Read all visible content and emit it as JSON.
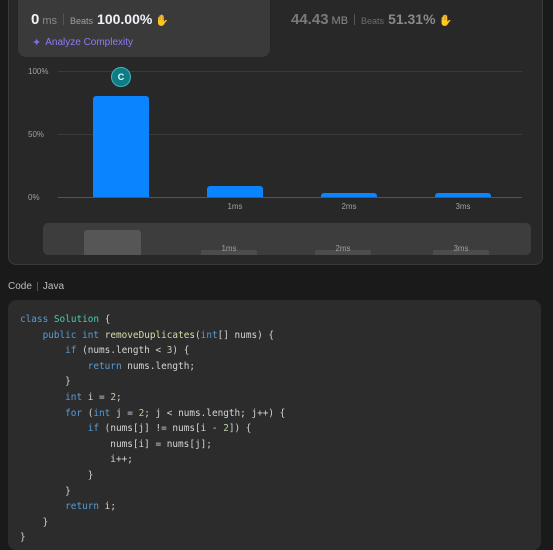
{
  "runtime": {
    "value": "0",
    "unit": "ms",
    "beats_label": "Beats",
    "beats_pct": "100.00%"
  },
  "memory": {
    "value": "44.43",
    "unit": "MB",
    "beats_label": "Beats",
    "beats_pct": "51.31%"
  },
  "analyze_label": "Analyze Complexity",
  "chart_data": {
    "type": "bar",
    "categories": [
      "",
      "1ms",
      "2ms",
      "3ms"
    ],
    "values": [
      80,
      9,
      3,
      3
    ],
    "ylim": [
      0,
      100
    ],
    "yticks": [
      "100%",
      "50%",
      "0%"
    ],
    "marker_label": "C",
    "marker_index": 0
  },
  "scrubber": {
    "ticks": [
      "1ms",
      "2ms",
      "3ms"
    ]
  },
  "code": {
    "label": "Code",
    "language": "Java"
  },
  "colors": {
    "accent": "#0a84ff",
    "success": "#2cbb5d",
    "ai": "#8b7cf6"
  }
}
